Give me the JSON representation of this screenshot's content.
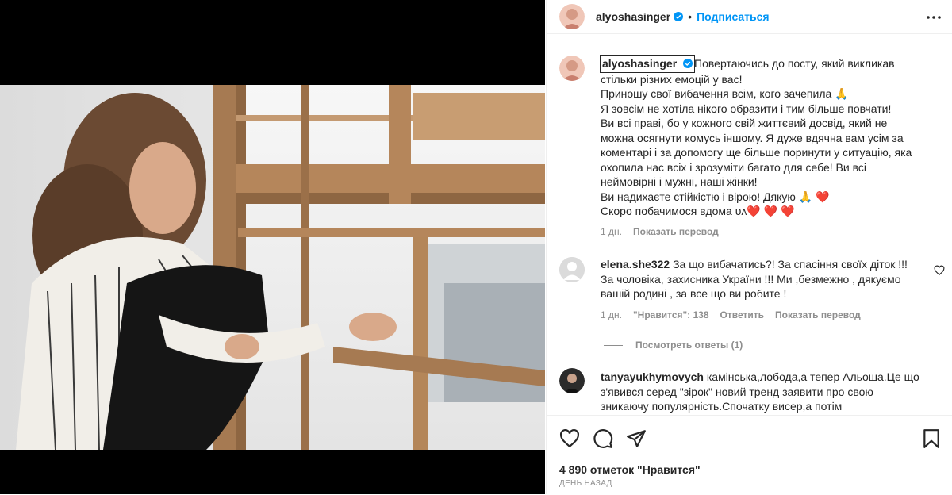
{
  "header": {
    "username": "alyoshasinger",
    "separator": "•",
    "follow_label": "Подписаться"
  },
  "caption": {
    "username": "alyoshasinger",
    "lines": [
      "Повертаючись до посту, який викликав",
      "стільки різних емоцій у вас!",
      "Приношу свої вибачення всім, кого зачепила 🙏",
      "Я зовсім не хотіла нікого образити і тим більше повчати!",
      "Ви всі праві, бо у кожного свій життєвий досвід, який не",
      "можна осягнути комусь іншому. Я дуже вдячна вам усім за",
      "коментарі і за допомогу ще більше поринути у ситуацію, яка",
      "охопила нас всіх і зрозуміти багато для себе! Ви всі",
      "неймовірні і мужні, наші жінки!",
      "Ви надихаєте стійкістю і вірою! Дякую 🙏 ❤️",
      "Скоро побачимося вдома ᴜᴀ❤️ ❤️ ❤️"
    ],
    "time": "1 дн.",
    "translate": "Показать перевод"
  },
  "comments": [
    {
      "username": "elena.she322",
      "lines": [
        "За що вибачатись?! За спасіння своїх діток !!!",
        "За чоловіка, захисника України !!! Ми ,безмежно , дякуємо",
        "вашій родині , за все що ви робите !"
      ],
      "time": "1 дн.",
      "likes": "\"Нравится\": 138",
      "reply": "Ответить",
      "translate": "Показать перевод",
      "view_replies": "Посмотреть ответы (1)"
    },
    {
      "username": "tanyayukhymovych",
      "lines": [
        "камінська,лобода,а тепер Альоша.Це що",
        "з'явився серед \"зірок\" новий тренд заявити про свою",
        "зникаючу популярність.Спочатку висер,а потім"
      ]
    }
  ],
  "footer": {
    "likes_count": "4 890 отметок \"Нравится\"",
    "date": "ДЕНЬ НАЗАД"
  },
  "icons": {
    "like": "heart-icon",
    "comment": "comment-icon",
    "share": "send-icon",
    "save": "bookmark-icon",
    "more": "more-options-icon",
    "verified": "verified-badge-icon"
  },
  "colors": {
    "accent": "#0095f6",
    "text": "#262626",
    "secondary": "#8e8e8e",
    "verified": "#0095f6",
    "heart": "#ed4956"
  }
}
